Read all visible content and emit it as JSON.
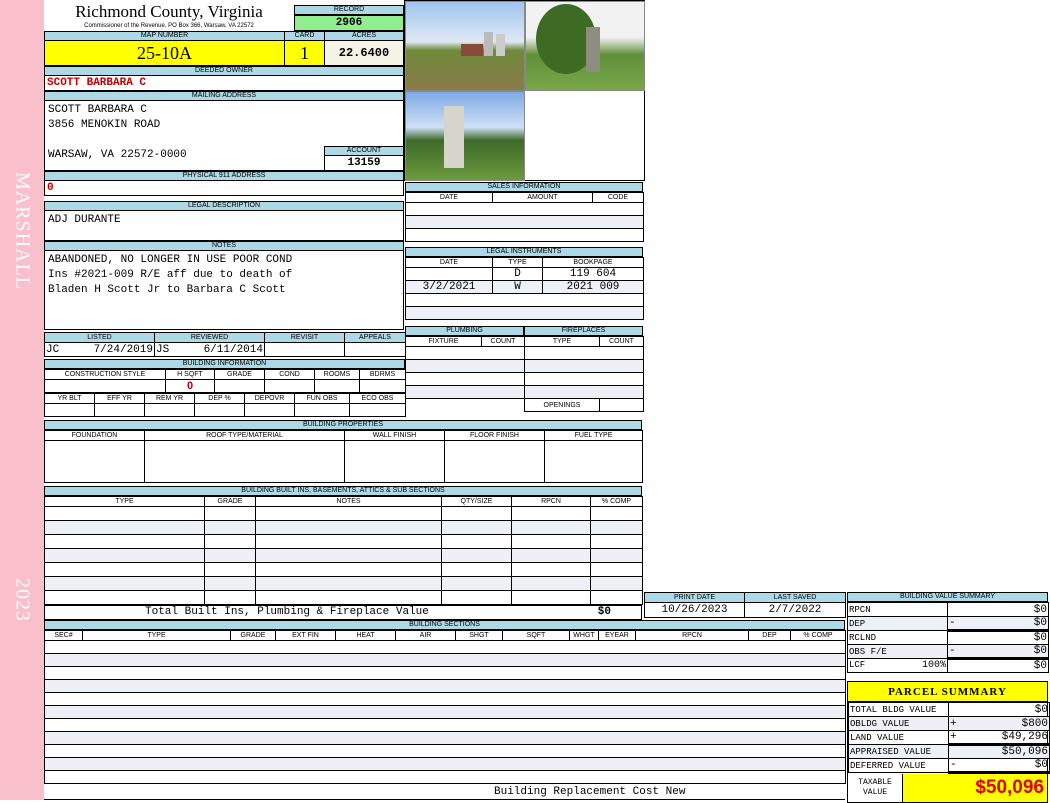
{
  "sidebar": {
    "name": "MARSHALL",
    "year": "2023"
  },
  "header": {
    "county": "Richmond County, Virginia",
    "subtitle": "Commissioner of the Revenue, PO Box 366, Warsaw, VA 22572",
    "record_label": "RECORD",
    "record": "2906",
    "map_label": "MAP NUMBER",
    "map_number": "25-10A",
    "card_label": "CARD",
    "card": "1",
    "acres_label": "ACRES",
    "acres": "22.6400"
  },
  "owner": {
    "label": "DEEDED OWNER",
    "name": "SCOTT BARBARA C"
  },
  "mailing": {
    "label": "MAILING ADDRESS",
    "line1": "SCOTT BARBARA C",
    "line2": "3856 MENOKIN ROAD",
    "line3": "WARSAW, VA 22572-0000",
    "account_label": "ACCOUNT",
    "account": "13159"
  },
  "physical": {
    "label": "PHYSICAL 911 ADDRESS",
    "value": "0"
  },
  "legal_desc": {
    "label": "LEGAL DESCRIPTION",
    "value": "ADJ DURANTE"
  },
  "notes": {
    "label": "NOTES",
    "line1": "ABANDONED, NO LONGER IN USE POOR COND",
    "line2": "Ins #2021-009 R/E aff due to death of",
    "line3": "Bladen H Scott Jr to Barbara C Scott"
  },
  "review": {
    "listed_label": "LISTED",
    "reviewed_label": "REVIEWED",
    "revisit_label": "REVISIT",
    "appeals_label": "APPEALS",
    "listed_by": "JC",
    "listed_date": "7/24/2019",
    "reviewed_by": "JS",
    "reviewed_date": "6/11/2014"
  },
  "building_info": {
    "title": "BUILDING INFORMATION",
    "cols1": [
      "CONSTRUCTION STYLE",
      "H SQFT",
      "GRADE",
      "COND",
      "ROOMS",
      "BDRMS"
    ],
    "hsqft": "0",
    "cols2": [
      "YR BLT",
      "EFF YR",
      "REM YR",
      "DEP %",
      "DEPOVR",
      "FUN OBS",
      "ECO OBS"
    ]
  },
  "sales": {
    "title": "SALES INFORMATION",
    "cols": [
      "DATE",
      "AMOUNT",
      "CODE"
    ]
  },
  "legal_instruments": {
    "title": "LEGAL INSTRUMENTS",
    "cols": [
      "DATE",
      "TYPE",
      "BOOKPAGE"
    ],
    "rows": [
      {
        "date": "",
        "type": "D",
        "book": "119 604"
      },
      {
        "date": "3/2/2021",
        "type": "W",
        "book": "2021 009"
      }
    ]
  },
  "plumbing": {
    "title": "PLUMBING",
    "cols": [
      "FIXTURE",
      "COUNT"
    ]
  },
  "fireplaces": {
    "title": "FIREPLACES",
    "cols": [
      "TYPE",
      "COUNT"
    ],
    "openings_label": "OPENINGS"
  },
  "building_properties": {
    "title": "BUILDING PROPERTIES",
    "cols": [
      "FOUNDATION",
      "ROOF TYPE/MATERIAL",
      "WALL FINISH",
      "FLOOR FINISH",
      "FUEL TYPE"
    ]
  },
  "built_ins": {
    "title": "BUILDING BUILT INS, BASEMENTS, ATTICS & SUB SECTIONS",
    "cols": [
      "TYPE",
      "GRADE",
      "NOTES",
      "QTY/SIZE",
      "RPCN",
      "% COMP"
    ],
    "total_label": "Total Built Ins, Plumbing & Fireplace Value",
    "total": "$0"
  },
  "dates": {
    "print_label": "PRINT DATE",
    "print_date": "10/26/2023",
    "saved_label": "LAST SAVED",
    "last_saved": "2/7/2022"
  },
  "sections": {
    "title": "BUILDING SECTIONS",
    "cols": [
      "SEC#",
      "TYPE",
      "GRADE",
      "EXT FIN",
      "HEAT",
      "AIR",
      "SHGT",
      "SQFT",
      "WHGT",
      "EYEAR",
      "RPCN",
      "DEP",
      "% COMP"
    ],
    "footer": "Building Replacement Cost New"
  },
  "bvs": {
    "title": "BUILDING VALUE SUMMARY",
    "rows": [
      {
        "label": "RPCN",
        "sign": "",
        "value": "$0"
      },
      {
        "label": "DEP",
        "sign": "-",
        "value": "$0"
      },
      {
        "label": "RCLND",
        "sign": "",
        "value": "$0"
      },
      {
        "label": "OBS F/E",
        "sign": "-",
        "value": "$0"
      },
      {
        "label": "LCF",
        "pct": "100%",
        "sign": "",
        "value": "$0"
      }
    ]
  },
  "parcel": {
    "title": "PARCEL SUMMARY",
    "rows": [
      {
        "label": "TOTAL BLDG VALUE",
        "sign": "",
        "value": "$0"
      },
      {
        "label": "OBLDG VALUE",
        "sign": "+",
        "value": "$800"
      },
      {
        "label": "LAND VALUE",
        "sign": "+",
        "value": "$49,296"
      },
      {
        "label": "APPRAISED VALUE",
        "sign": "",
        "value": "$50,096"
      },
      {
        "label": "DEFERRED VALUE",
        "sign": "-",
        "value": "$0"
      }
    ],
    "taxable_label": "TAXABLE VALUE",
    "taxable": "$50,096"
  },
  "colors": {
    "sidebar": "#f9c0cb",
    "header": "#add8e6",
    "highlight": "#ffff00",
    "record": "#90ee90"
  }
}
